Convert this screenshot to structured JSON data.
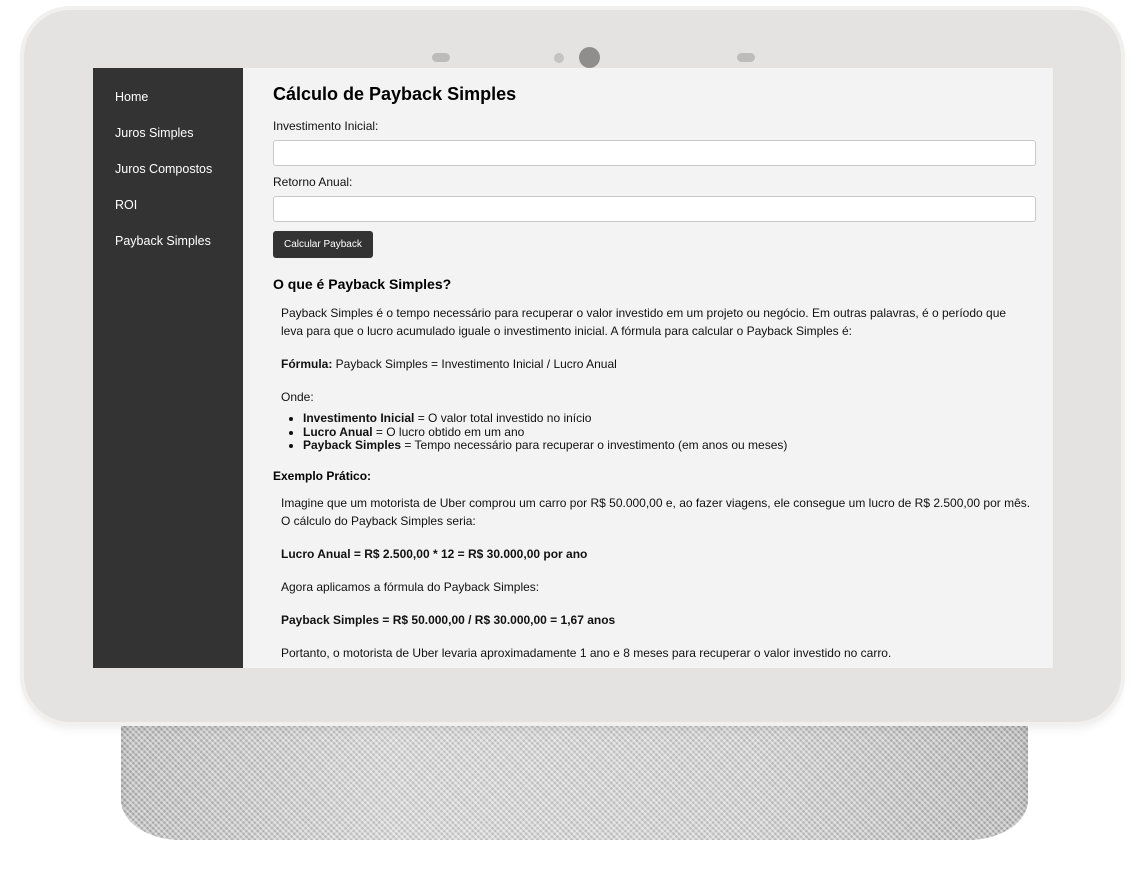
{
  "sidebar": {
    "items": [
      {
        "label": "Home"
      },
      {
        "label": "Juros Simples"
      },
      {
        "label": "Juros Compostos"
      },
      {
        "label": "ROI"
      },
      {
        "label": "Payback Simples"
      }
    ]
  },
  "form": {
    "title": "Cálculo de Payback Simples",
    "investimento_label": "Investimento Inicial:",
    "investimento_value": "",
    "retorno_label": "Retorno Anual:",
    "retorno_value": "",
    "button_label": "Calcular Payback"
  },
  "info": {
    "heading": "O que é Payback Simples?",
    "intro_line1": "Payback Simples é o tempo necessário para recuperar o valor investido em um projeto ou negócio. Em outras palavras, é o período que",
    "intro_line2": "leva para que o lucro acumulado iguale o investimento inicial. A fórmula para calcular o Payback Simples é:",
    "formula_label": "Fórmula:",
    "formula_text": " Payback Simples = Investimento Inicial / Lucro Anual",
    "onde": "Onde:",
    "definitions": [
      {
        "term": "Investimento Inicial",
        "text": " = O valor total investido no início"
      },
      {
        "term": "Lucro Anual",
        "text": " = O lucro obtido em um ano"
      },
      {
        "term": "Payback Simples",
        "text": " = Tempo necessário para recuperar o investimento (em anos ou meses)"
      }
    ]
  },
  "exemplo": {
    "heading": "Exemplo Prático:",
    "line1": "Imagine que um motorista de Uber comprou um carro por R$ 50.000,00 e, ao fazer viagens, ele consegue um lucro de R$ 2.500,00 por mês.",
    "line2": "O cálculo do Payback Simples seria:",
    "lucro_anual": "Lucro Anual = R$ 2.500,00 * 12 = R$ 30.000,00 por ano",
    "agora": "Agora aplicamos a fórmula do Payback Simples:",
    "payback": "Payback Simples = R$ 50.000,00 / R$ 30.000,00 = 1,67 anos",
    "conclusao": "Portanto, o motorista de Uber levaria aproximadamente 1 ano e 8 meses para recuperar o valor investido no carro."
  }
}
